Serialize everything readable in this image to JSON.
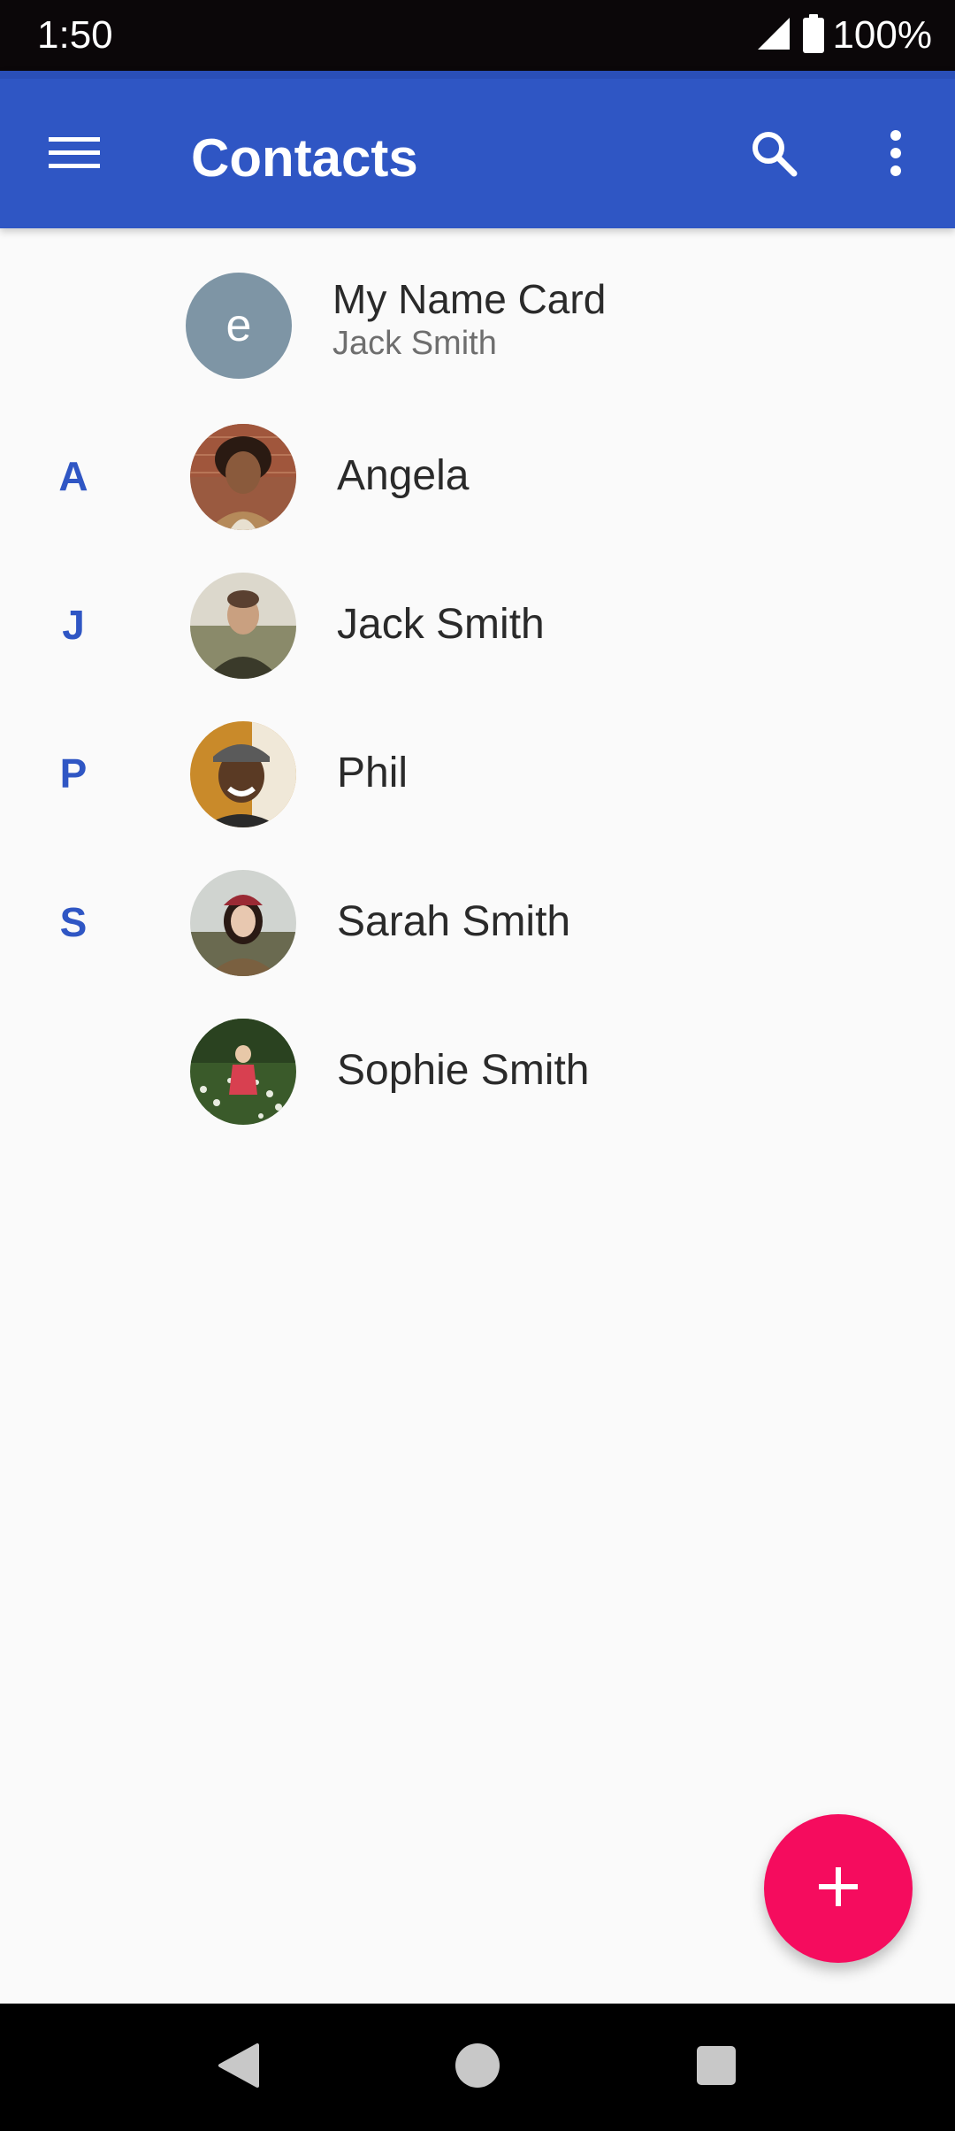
{
  "status_bar": {
    "time": "1:50",
    "battery_percent": "100%",
    "icons": [
      "signal-icon",
      "battery-icon"
    ]
  },
  "app_bar": {
    "title": "Contacts",
    "icons": [
      "menu-icon",
      "search-icon",
      "more-vert-icon"
    ],
    "background_color": "#2f56c4"
  },
  "name_card": {
    "avatar_letter": "e",
    "title": "My Name Card",
    "subtitle": "Jack Smith"
  },
  "contacts": [
    {
      "section": "A",
      "name": "Angela"
    },
    {
      "section": "J",
      "name": "Jack Smith"
    },
    {
      "section": "P",
      "name": "Phil"
    },
    {
      "section": "S",
      "name": "Sarah Smith"
    },
    {
      "section": "",
      "name": "Sophie Smith"
    }
  ],
  "fab": {
    "icon": "add-icon",
    "color": "#f50c5e"
  },
  "nav_bar": {
    "icons": [
      "back-icon",
      "home-icon",
      "recents-icon"
    ]
  }
}
